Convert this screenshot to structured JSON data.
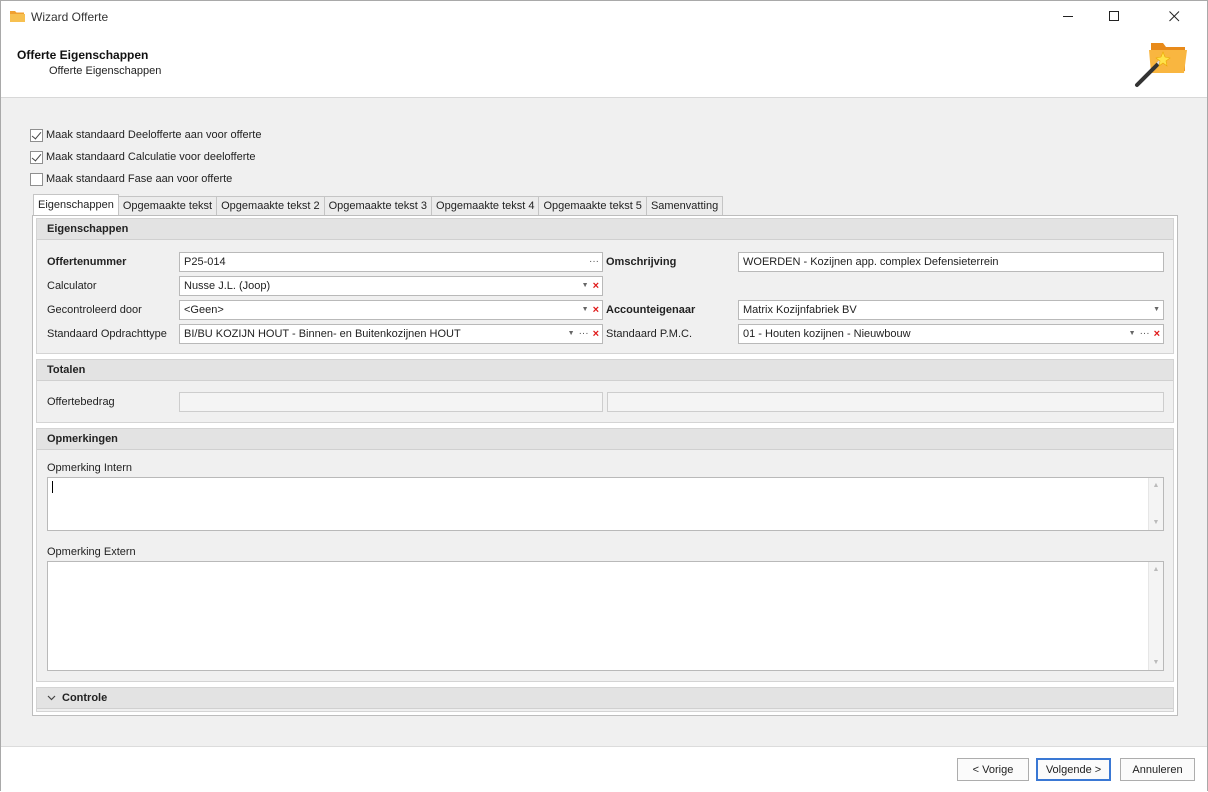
{
  "window": {
    "title": "Wizard Offerte"
  },
  "header": {
    "title": "Offerte Eigenschappen",
    "subtitle": "Offerte Eigenschappen"
  },
  "options": [
    {
      "label": "Maak standaard Deelofferte aan voor offerte",
      "checked": true
    },
    {
      "label": "Maak standaard Calculatie voor deelofferte",
      "checked": true
    },
    {
      "label": "Maak standaard Fase aan voor offerte",
      "checked": false
    }
  ],
  "tabs": [
    {
      "label": "Eigenschappen",
      "active": true
    },
    {
      "label": "Opgemaakte tekst",
      "active": false
    },
    {
      "label": "Opgemaakte tekst 2",
      "active": false
    },
    {
      "label": "Opgemaakte tekst 3",
      "active": false
    },
    {
      "label": "Opgemaakte tekst 4",
      "active": false
    },
    {
      "label": "Opgemaakte tekst 5",
      "active": false
    },
    {
      "label": "Samenvatting",
      "active": false
    }
  ],
  "eigenschappen": {
    "heading": "Eigenschappen",
    "offertenummer": {
      "label": "Offertenummer",
      "value": "P25-014"
    },
    "calculator": {
      "label": "Calculator",
      "value": "Nusse J.L. (Joop)"
    },
    "gecontroleerd": {
      "label": "Gecontroleerd door",
      "value": "<Geen>"
    },
    "opdrachttype": {
      "label": "Standaard Opdrachttype",
      "value": "BI/BU KOZIJN HOUT - Binnen- en Buitenkozijnen HOUT"
    },
    "omschrijving": {
      "label": "Omschrijving",
      "value": "WOERDEN - Kozijnen app. complex Defensieterrein"
    },
    "accounteigenaar": {
      "label": "Accounteigenaar",
      "value": "Matrix Kozijnfabriek BV"
    },
    "pmc": {
      "label": "Standaard P.M.C.",
      "value": "01 - Houten kozijnen - Nieuwbouw"
    }
  },
  "totalen": {
    "heading": "Totalen",
    "offertebedrag": {
      "label": "Offertebedrag",
      "value": "",
      "value2": ""
    }
  },
  "opmerkingen": {
    "heading": "Opmerkingen",
    "intern_label": "Opmerking Intern",
    "intern_value": "",
    "extern_label": "Opmerking Extern",
    "extern_value": ""
  },
  "controle": {
    "heading": "Controle"
  },
  "footer": {
    "prev": "< Vorige",
    "next": "Volgende >",
    "cancel": "Annuleren"
  },
  "colors": {
    "accent": "#3a78d4",
    "clear": "#e01818"
  }
}
